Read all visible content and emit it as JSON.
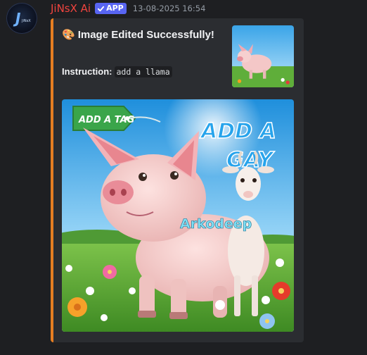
{
  "message": {
    "username": "JiNsX Ai",
    "app_badge": "APP",
    "timestamp": "13-08-2025 16:54"
  },
  "embed": {
    "title_emoji": "🎨",
    "title": "Image Edited Successfully!",
    "field_name": "Instruction:",
    "field_value": "add a llama",
    "accent_color": "#e67e22"
  },
  "image": {
    "tag_text": "ADD A TAG",
    "headline": "ADD A GAY",
    "watermark": "Arkodeep"
  },
  "icons": [
    "avatar-logo",
    "verified-check-icon",
    "palette-emoji"
  ]
}
